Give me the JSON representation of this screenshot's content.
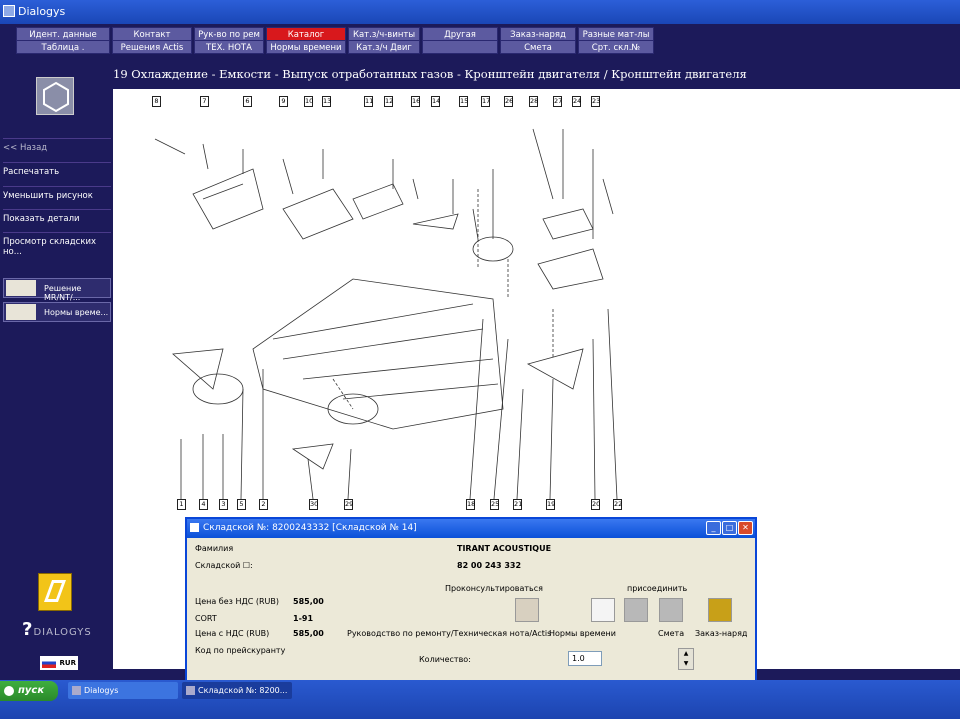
{
  "window": {
    "title": "Dialogys"
  },
  "menu": {
    "row1": [
      "Идент. данные",
      "Контакт",
      "Рук-во по рем",
      "Каталог запчастей",
      "Кат.з/ч-винты",
      "Другая",
      "Заказ-наряд",
      "Разные мат-лы"
    ],
    "row2": [
      "Таблица .",
      "Решения Actis",
      "ТЕХ. НОТА",
      "Нормы времени",
      "Кат.з/ч Двиг",
      "",
      "Смета",
      "Срт. скл.№"
    ],
    "active": "Каталог запчастей"
  },
  "left_panel": {
    "back": "<< Назад",
    "items": [
      "Распечатать",
      "Уменьшить рисунок",
      "Показать детали",
      "Просмотр складских но..."
    ],
    "buttons": [
      "Решение MR/NT/...",
      "Нормы време..."
    ],
    "logo": "DIALOGYS",
    "currency": "RUR"
  },
  "page_title": "19 Охлаждение - Емкости - Выпуск отработанных газов - Кронштейн двигателя / Кронштейн двигателя",
  "callouts": {
    "top": [
      "8",
      "7",
      "6",
      "9",
      "10",
      "13",
      "11",
      "12",
      "16",
      "14",
      "15",
      "17",
      "26",
      "28",
      "27",
      "24",
      "23"
    ],
    "bottom": [
      "1",
      "4",
      "3",
      "5",
      "2",
      "30",
      "29",
      "18",
      "25",
      "21",
      "19",
      "20",
      "22"
    ]
  },
  "dialog": {
    "title": "Складской №: 8200243332 [Складской № 14]",
    "family_label": "Фамилия",
    "family_value": "TIRANT ACOUSTIQUE",
    "sklad_label": "Складской ☐:",
    "sklad_value": "82 00 243 332",
    "price_no_vat_label": "Цена без НДС (RUB)",
    "price_no_vat": "585,00",
    "cort_label": "CORT",
    "cort": "1-91",
    "price_vat_label": "Цена с НДС (RUB)",
    "price_vat": "585,00",
    "code_label": "Код по прейскуранту",
    "consult": "Проконсультироваться",
    "join": "присоединить",
    "manual": "Руководство по ремонту/Техническая нота/Actis",
    "norms": "Нормы времени",
    "estimate": "Смета",
    "order": "Заказ-наряд",
    "qty_label": "Количество:",
    "qty": "1.0"
  },
  "taskbar": {
    "start": "пуск",
    "apps": [
      "Dialogys",
      "Складской №: 8200..."
    ]
  }
}
